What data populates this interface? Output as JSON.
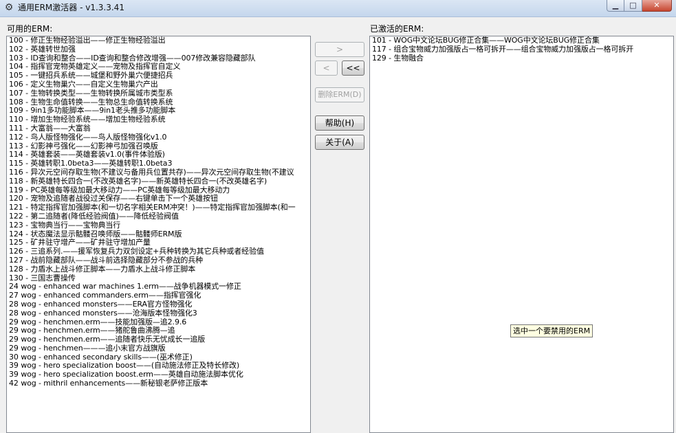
{
  "window": {
    "title": "通用ERM激活器 - v1.3.3.41",
    "app_icon": "gear-icon",
    "controls": {
      "minimize": "▁",
      "maximize": "□",
      "close": "✕"
    }
  },
  "available": {
    "label": "可用的ERM:",
    "items": [
      "100 - 修正生物经验溢出——修正生物经验溢出",
      "102 - 英雄转世加强",
      "103 - ID查询和整合——ID查询和整合修改增强——007修改兼容隐藏部队",
      "104 - 指挥官宠物英雄定义——宠物及指挥官自定义",
      "105 - 一键招兵系统——城堡和野外巢穴便捷招兵",
      "106 - 定义生物巢穴——自定义生物巢穴产出",
      "107 - 生物转换类型——生物转换所属城市类型系",
      "108 - 生物生命值转换——生物总生命值转换系统",
      "109 - 9in1多功能脚本——9in1老头推多功能脚本",
      "110 - 增加生物经验系统——增加生物经验系统",
      "111 - 大富翁——大富翁",
      "112 - 鸟人版怪物强化——鸟人版怪物强化v1.0",
      "113 - 幻影神弓强化——幻影神弓加强召唤版",
      "114 - 英雄套装——英雄套装v1.0(事件体验版)",
      "115 - 英雄转职1.0beta3——英雄转职1.0beta3",
      "116 - 异次元空间存取生物(不建议与备用兵位置共存)——异次元空间存取生物(不建议",
      "118 - 新英雄特长四合一(不改英雄名字)——新英雄特长四合一(不改英雄名字)",
      "119 - PC英雄每等级加最大移动力——PC英雄每等级加最大移动力",
      "120 - 宠物及追随者战役过关保存——右键单击下一个英雄按钮",
      "121 - 特定指挥官加强脚本(和一切名字相关ERM冲突！)——特定指挥官加强脚本(和一",
      "122 - 第二追随者(降低经验阀值)——降低经验阀值",
      "123 - 宝物典当行——宝物典当行",
      "124 - 状态魔法显示骷髅召唤师版——骷髅师ERM版",
      "125 - 矿井驻守增产——矿井驻守增加产量",
      "126 - 三追系列.——援军恢复兵力双剑设定+兵种转换为其它兵种或者经验值",
      "127 - 战前隐藏部队——战斗前选择隐藏部分不参战的兵种",
      "128 - 力盾水上战斗修正脚本——力盾水上战斗修正脚本",
      "130 - 三国志曹操传",
      "24 wog - enhanced war machines 1.erm——战争机器模式一修正",
      "27 wog - enhanced commanders.erm——指挥官强化",
      "28 wog - enhanced monsters——ERA官方怪物强化",
      "28 wog - enhanced monsters——沧海版本怪物强化3",
      "29 wog - henchmen.erm——技能加强版—追2.9.6",
      "29 wog - henchmen.erm——猪舵鲁曲沸腾—追",
      "29 wog - henchmen.erm——追随者快乐无忧成长一追版",
      "29 wog - henchmen———追小末官方战旗版",
      "30 wog - enhanced secondary skills——(巫术修正)",
      "39 wog - hero specialization boost——(自动施法修正及特长修改)",
      "39 wog - hero specialization boost.erm——英雄自动施法脚本优化",
      "42 wog - mithril enhancements——新秘银老萨修正版本"
    ]
  },
  "activated": {
    "label": "已激活的ERM:",
    "items": [
      "101 - WOG中文论坛BUG修正合集——WOG中文论坛BUG修正合集",
      "117 - 组合宝物威力加强版占一格可拆开——组合宝物威力加强版占一格可拆开",
      "129 - 生物融合"
    ]
  },
  "buttons": {
    "add_one": ">",
    "remove_one": "<",
    "remove_all": "<<",
    "delete": "删除ERM(D)",
    "help": "帮助(H)",
    "about": "关于(A)"
  },
  "tooltip": "选中一个要禁用的ERM"
}
